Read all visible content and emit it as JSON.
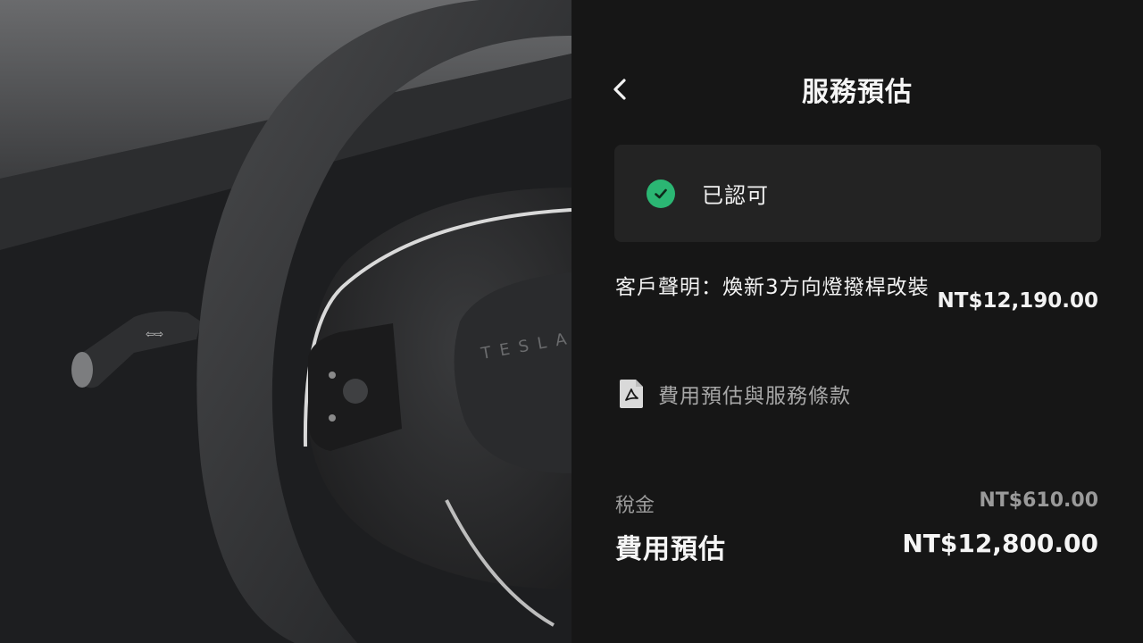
{
  "header": {
    "title": "服務預估"
  },
  "status": {
    "label": "已認可",
    "color": "#2bb673"
  },
  "claim": {
    "description": "客戶聲明：煥新3方向燈撥桿改裝",
    "amount": "NT$12,190.00"
  },
  "document": {
    "label": "費用預估與服務條款",
    "icon": "pdf-icon"
  },
  "tax": {
    "label": "稅金",
    "amount": "NT$610.00"
  },
  "total": {
    "label": "費用預估",
    "amount": "NT$12,800.00"
  },
  "photo": {
    "wheel_badge": "TESLA"
  }
}
